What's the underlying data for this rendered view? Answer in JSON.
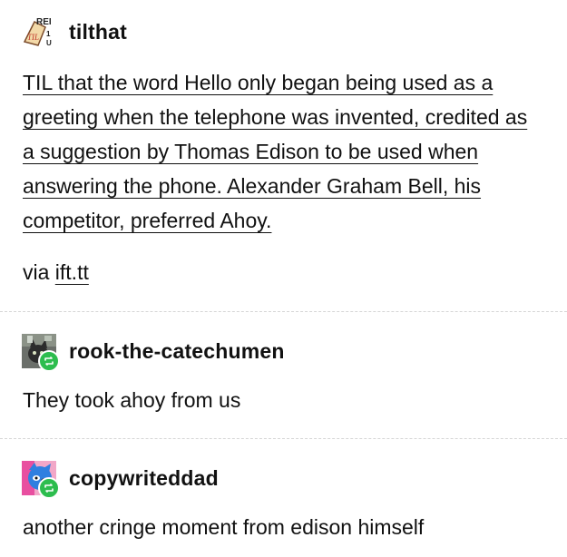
{
  "posts": [
    {
      "username": "tilthat",
      "avatar_icon": "til-logo-icon",
      "avatar_text": "REI TIL",
      "body": "TIL that the word Hello only began being used as a greeting when the telephone was invented, credited as a suggestion by Thomas Edison to be used when answering the phone. Alexander Graham Bell, his competitor, preferred Ahoy.",
      "via_prefix": "via ",
      "via_link": "ift.tt"
    },
    {
      "username": "rook-the-catechumen",
      "avatar_icon": "cat-avatar-icon",
      "badge_icon": "reblog-icon",
      "body": "They took ahoy from us"
    },
    {
      "username": "copywriteddad",
      "avatar_icon": "blue-character-avatar-icon",
      "badge_icon": "reblog-icon",
      "body": "another cringe moment from edison himself"
    }
  ],
  "colors": {
    "reblog_badge": "#2dbd4e",
    "divider": "#d6d6d6"
  }
}
